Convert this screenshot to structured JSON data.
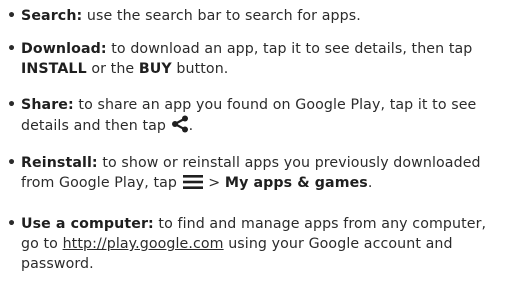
{
  "bullet_char": "•",
  "items": {
    "search": {
      "title": "Search:",
      "text": " use the search bar to search for apps."
    },
    "download": {
      "title": "Download:",
      "text_a": " to download an app, tap it to see details, then tap ",
      "install": "INSTALL",
      "text_b": " or the ",
      "buy": "BUY",
      "text_c": " button."
    },
    "share": {
      "title": "Share:",
      "text_a": " to share an app you found on Google Play, tap it to see details and then tap ",
      "text_b": ".",
      "icon": "share-icon"
    },
    "reinstall": {
      "title": "Reinstall:",
      "text_a": " to show or reinstall apps you previously downloaded from Google Play, tap ",
      "text_b": " > ",
      "myapps": "My apps & games",
      "text_c": ".",
      "icon": "menu-icon"
    },
    "computer": {
      "title": "Use a computer:",
      "text_a": " to find and manage apps from any computer, go to ",
      "link": "http://play.google.com",
      "text_b": " using your Google account and password."
    }
  }
}
